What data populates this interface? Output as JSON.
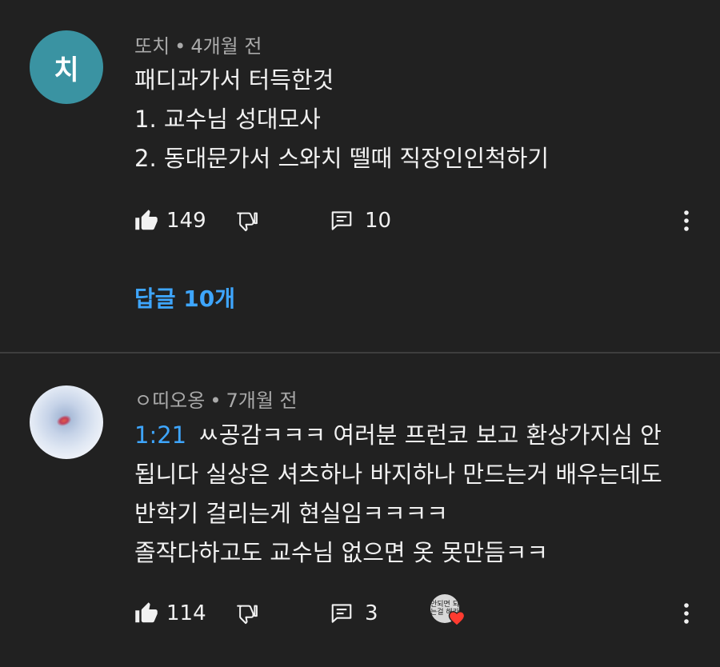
{
  "comments": [
    {
      "avatar_letter": "치",
      "author": "또치",
      "time": "4개월 전",
      "lines": [
        "패디과가서 터득한것",
        "1. 교수님 성대모사",
        "2. 동대문가서 스와치 뗄때 직장인인척하기"
      ],
      "likes": "149",
      "replies": "10",
      "replies_link": "답글 10개"
    },
    {
      "author": "ㅇ띠오옹",
      "time": "7개월 전",
      "timestamp": "1:21",
      "first_line": "ㅆ공감ㅋㅋㅋ 여러분 프런코 보고 환상가지심 안",
      "lines": [
        "됩니다 실상은 셔츠하나 바지하나 만드는거 배우는데도",
        "반학기 걸리는게 현실임ㅋㅋㅋㅋ",
        "졸작다하고도 교수님 없으면 옷 못만듬ㅋㅋ"
      ],
      "likes": "114",
      "replies": "3",
      "hearted_by_text": "안되면 되는걸 해라"
    }
  ],
  "meta_separator": "•",
  "icons": {
    "like": "thumbs-up-icon",
    "dislike": "thumbs-down-icon",
    "reply": "comment-icon",
    "more": "more-vert-icon",
    "heart": "heart-icon"
  },
  "colors": {
    "background": "#212121",
    "text": "#f1f1f1",
    "secondary": "#aaaaaa",
    "link": "#3ea6ff",
    "heart": "#ff3b30"
  }
}
